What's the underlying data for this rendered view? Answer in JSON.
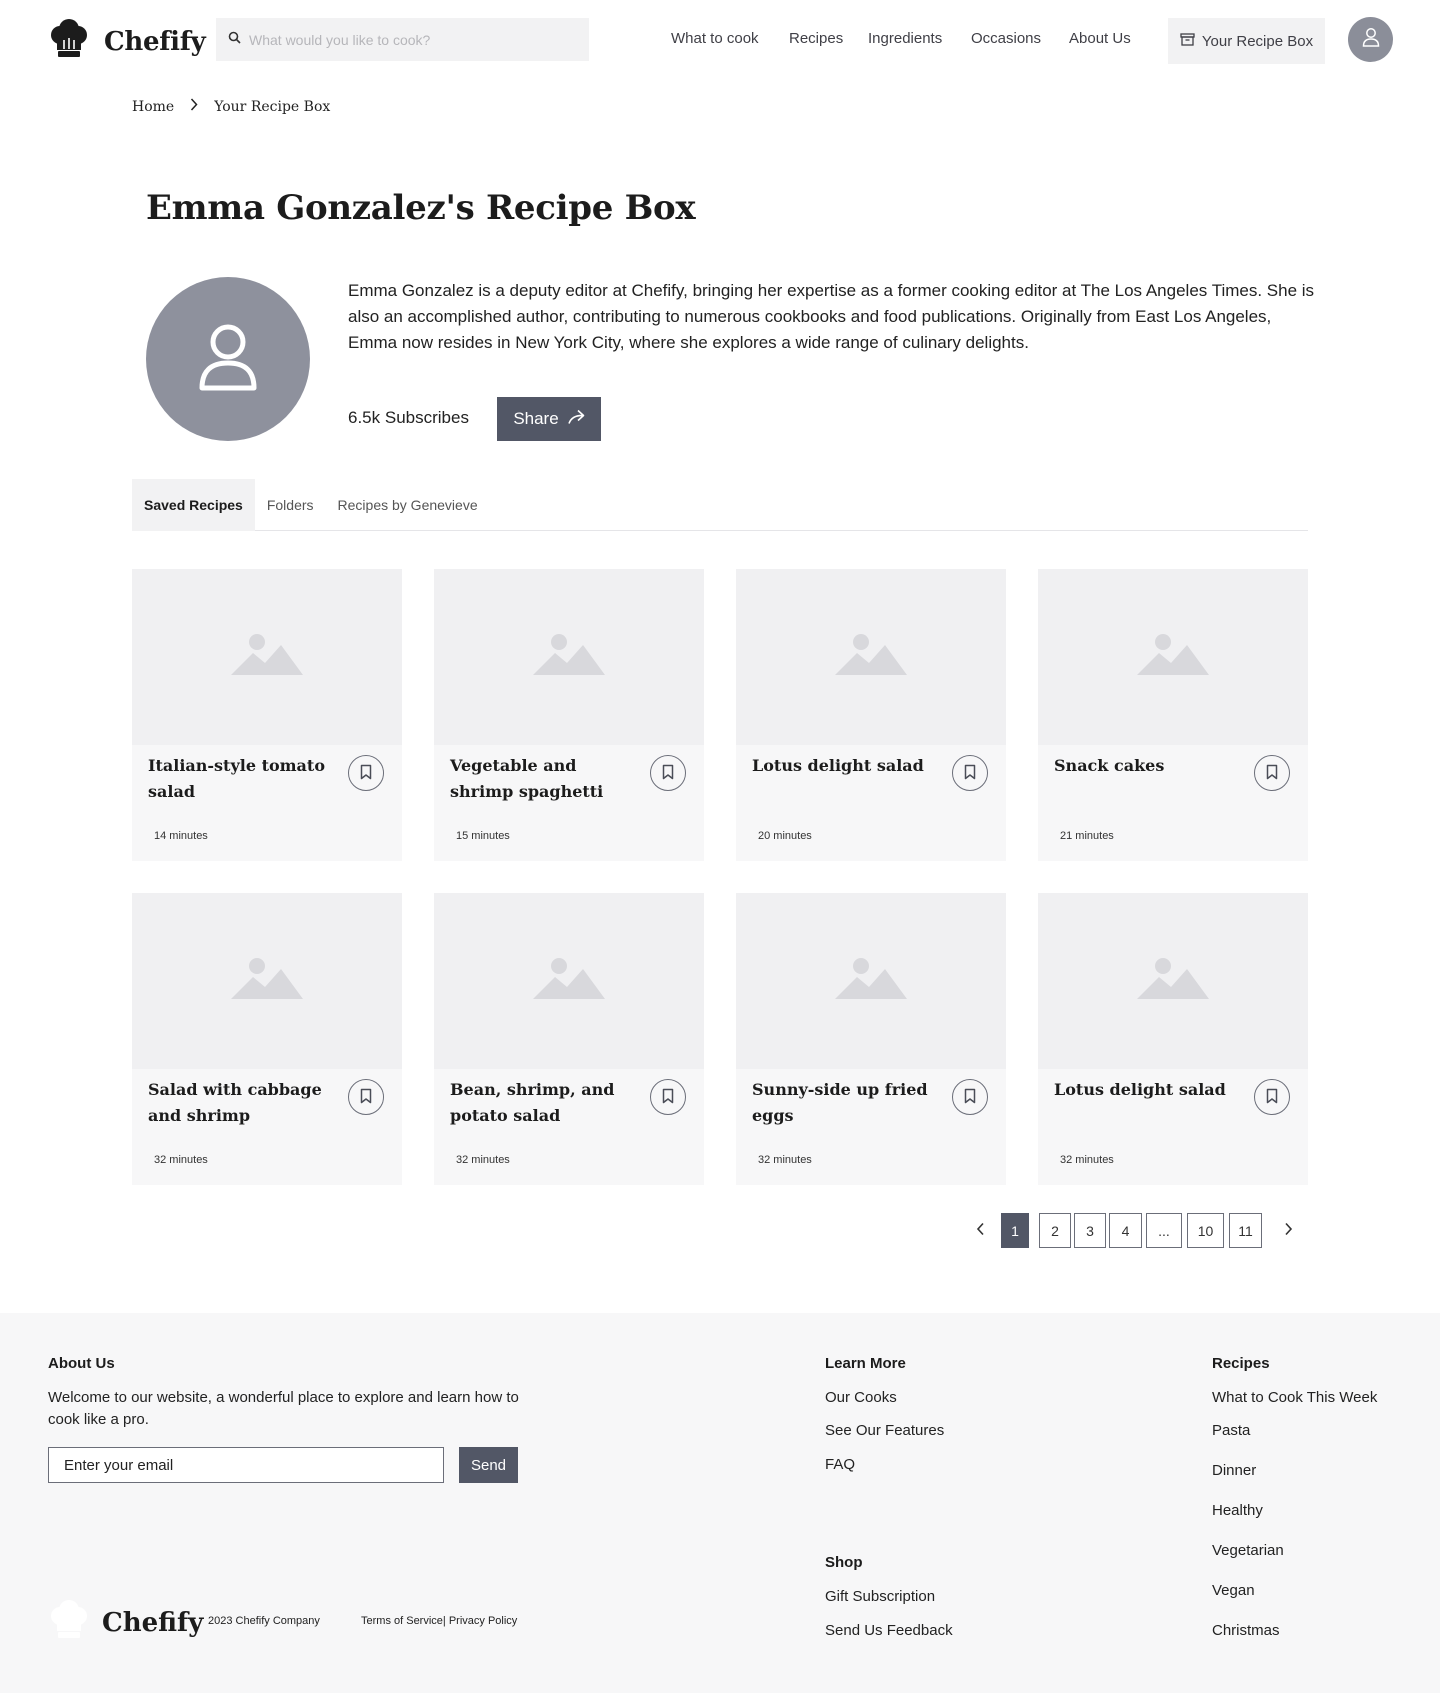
{
  "header": {
    "brand": "Chefify",
    "search_placeholder": "What would you like to cook?",
    "nav": [
      "What to cook",
      "Recipes",
      "Ingredients",
      "Occasions",
      "About Us"
    ],
    "recipe_box_label": "Your Recipe Box"
  },
  "breadcrumb": {
    "home": "Home",
    "current": "Your Recipe Box"
  },
  "profile": {
    "title": "Emma Gonzalez's Recipe Box",
    "bio": "Emma Gonzalez is a deputy editor at Chefify, bringing her expertise as a former cooking editor at The Los Angeles Times. She is also an accomplished author, contributing to numerous cookbooks and food publications. Originally from East Los Angeles, Emma now resides in New York City, where she explores a wide range of culinary delights.",
    "subscribes": "6.5k Subscribes",
    "share_label": "Share"
  },
  "tabs": [
    {
      "label": "Saved Recipes",
      "active": true
    },
    {
      "label": "Folders",
      "active": false
    },
    {
      "label": "Recipes by Genevieve",
      "active": false
    }
  ],
  "recipes": [
    {
      "title": "Italian-style tomato salad",
      "time": "14 minutes"
    },
    {
      "title": "Vegetable and shrimp spaghetti",
      "time": "15 minutes"
    },
    {
      "title": "Lotus delight salad",
      "time": "20 minutes"
    },
    {
      "title": "Snack cakes",
      "time": "21 minutes"
    },
    {
      "title": "Salad with cabbage and shrimp",
      "time": "32 minutes"
    },
    {
      "title": "Bean, shrimp, and potato salad",
      "time": "32 minutes"
    },
    {
      "title": "Sunny-side up fried eggs",
      "time": "32 minutes"
    },
    {
      "title": "Lotus delight salad",
      "time": "32 minutes"
    }
  ],
  "pagination": {
    "pages": [
      "1",
      "2",
      "3",
      "4",
      "...",
      "10",
      "11"
    ],
    "current": "1"
  },
  "footer": {
    "about_heading": "About Us",
    "about_text": "Welcome to our website, a wonderful place to explore and learn how to cook like a pro.",
    "email_placeholder": "Enter your email",
    "send_label": "Send",
    "learn_heading": "Learn More",
    "learn_links": [
      "Our Cooks",
      "See Our Features",
      "FAQ"
    ],
    "shop_heading": "Shop",
    "shop_links": [
      "Gift Subscription",
      "Send Us Feedback"
    ],
    "recipes_heading": "Recipes",
    "recipes_links": [
      "What to Cook This Week",
      "Pasta",
      "Dinner",
      "Healthy",
      "Vegetarian",
      "Vegan",
      "Christmas"
    ],
    "brand": "Chefify",
    "copyright": "2023 Chefify Company",
    "legal": "Terms of Service| Privacy Policy"
  },
  "icons": {
    "logo": "chef-hat-icon",
    "search": "search-icon",
    "recipe_box": "recipe-box-icon",
    "user": "user-icon",
    "chevron": "chevron-right-icon",
    "share": "share-arrow-icon",
    "image_placeholder": "image-placeholder-icon",
    "bookmark": "bookmark-icon"
  },
  "colors": {
    "accent": "#525766",
    "avatar": "#8e919d",
    "surface": "#f2f2f3"
  }
}
